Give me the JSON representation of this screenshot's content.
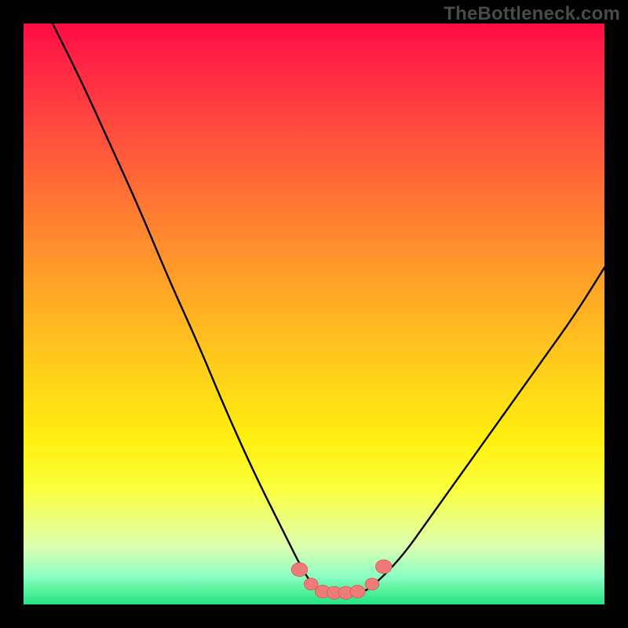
{
  "watermark": "TheBottleneck.com",
  "colors": {
    "frame": "#000000",
    "curve_stroke": "#000000",
    "marker_fill": "#ee7b78",
    "marker_stroke": "#d25c5a"
  },
  "chart_data": {
    "type": "line",
    "title": "",
    "xlabel": "",
    "ylabel": "",
    "xlim": [
      0,
      100
    ],
    "ylim": [
      0,
      100
    ],
    "grid": false,
    "legend": false,
    "series": [
      {
        "name": "bottleneck-curve",
        "x": [
          0,
          5,
          10,
          15,
          20,
          25,
          30,
          35,
          40,
          45,
          48,
          50,
          52,
          54,
          56,
          58,
          60,
          65,
          70,
          75,
          80,
          85,
          90,
          95,
          100
        ],
        "y": [
          110,
          100,
          90,
          79,
          68,
          56,
          45,
          33,
          22,
          12,
          6,
          3,
          2,
          2,
          2,
          2,
          3,
          8,
          15,
          22,
          29,
          36,
          43,
          50,
          58
        ]
      }
    ],
    "markers": [
      {
        "x": 47.5,
        "y": 6,
        "r": 1.4
      },
      {
        "x": 49.5,
        "y": 3.5,
        "r": 1.2
      },
      {
        "x": 51.5,
        "y": 2.2,
        "r": 1.3
      },
      {
        "x": 53.5,
        "y": 2.0,
        "r": 1.3
      },
      {
        "x": 55.5,
        "y": 2.0,
        "r": 1.3
      },
      {
        "x": 57.5,
        "y": 2.2,
        "r": 1.3
      },
      {
        "x": 60.0,
        "y": 3.5,
        "r": 1.2
      },
      {
        "x": 62.0,
        "y": 6.5,
        "r": 1.4
      }
    ]
  }
}
